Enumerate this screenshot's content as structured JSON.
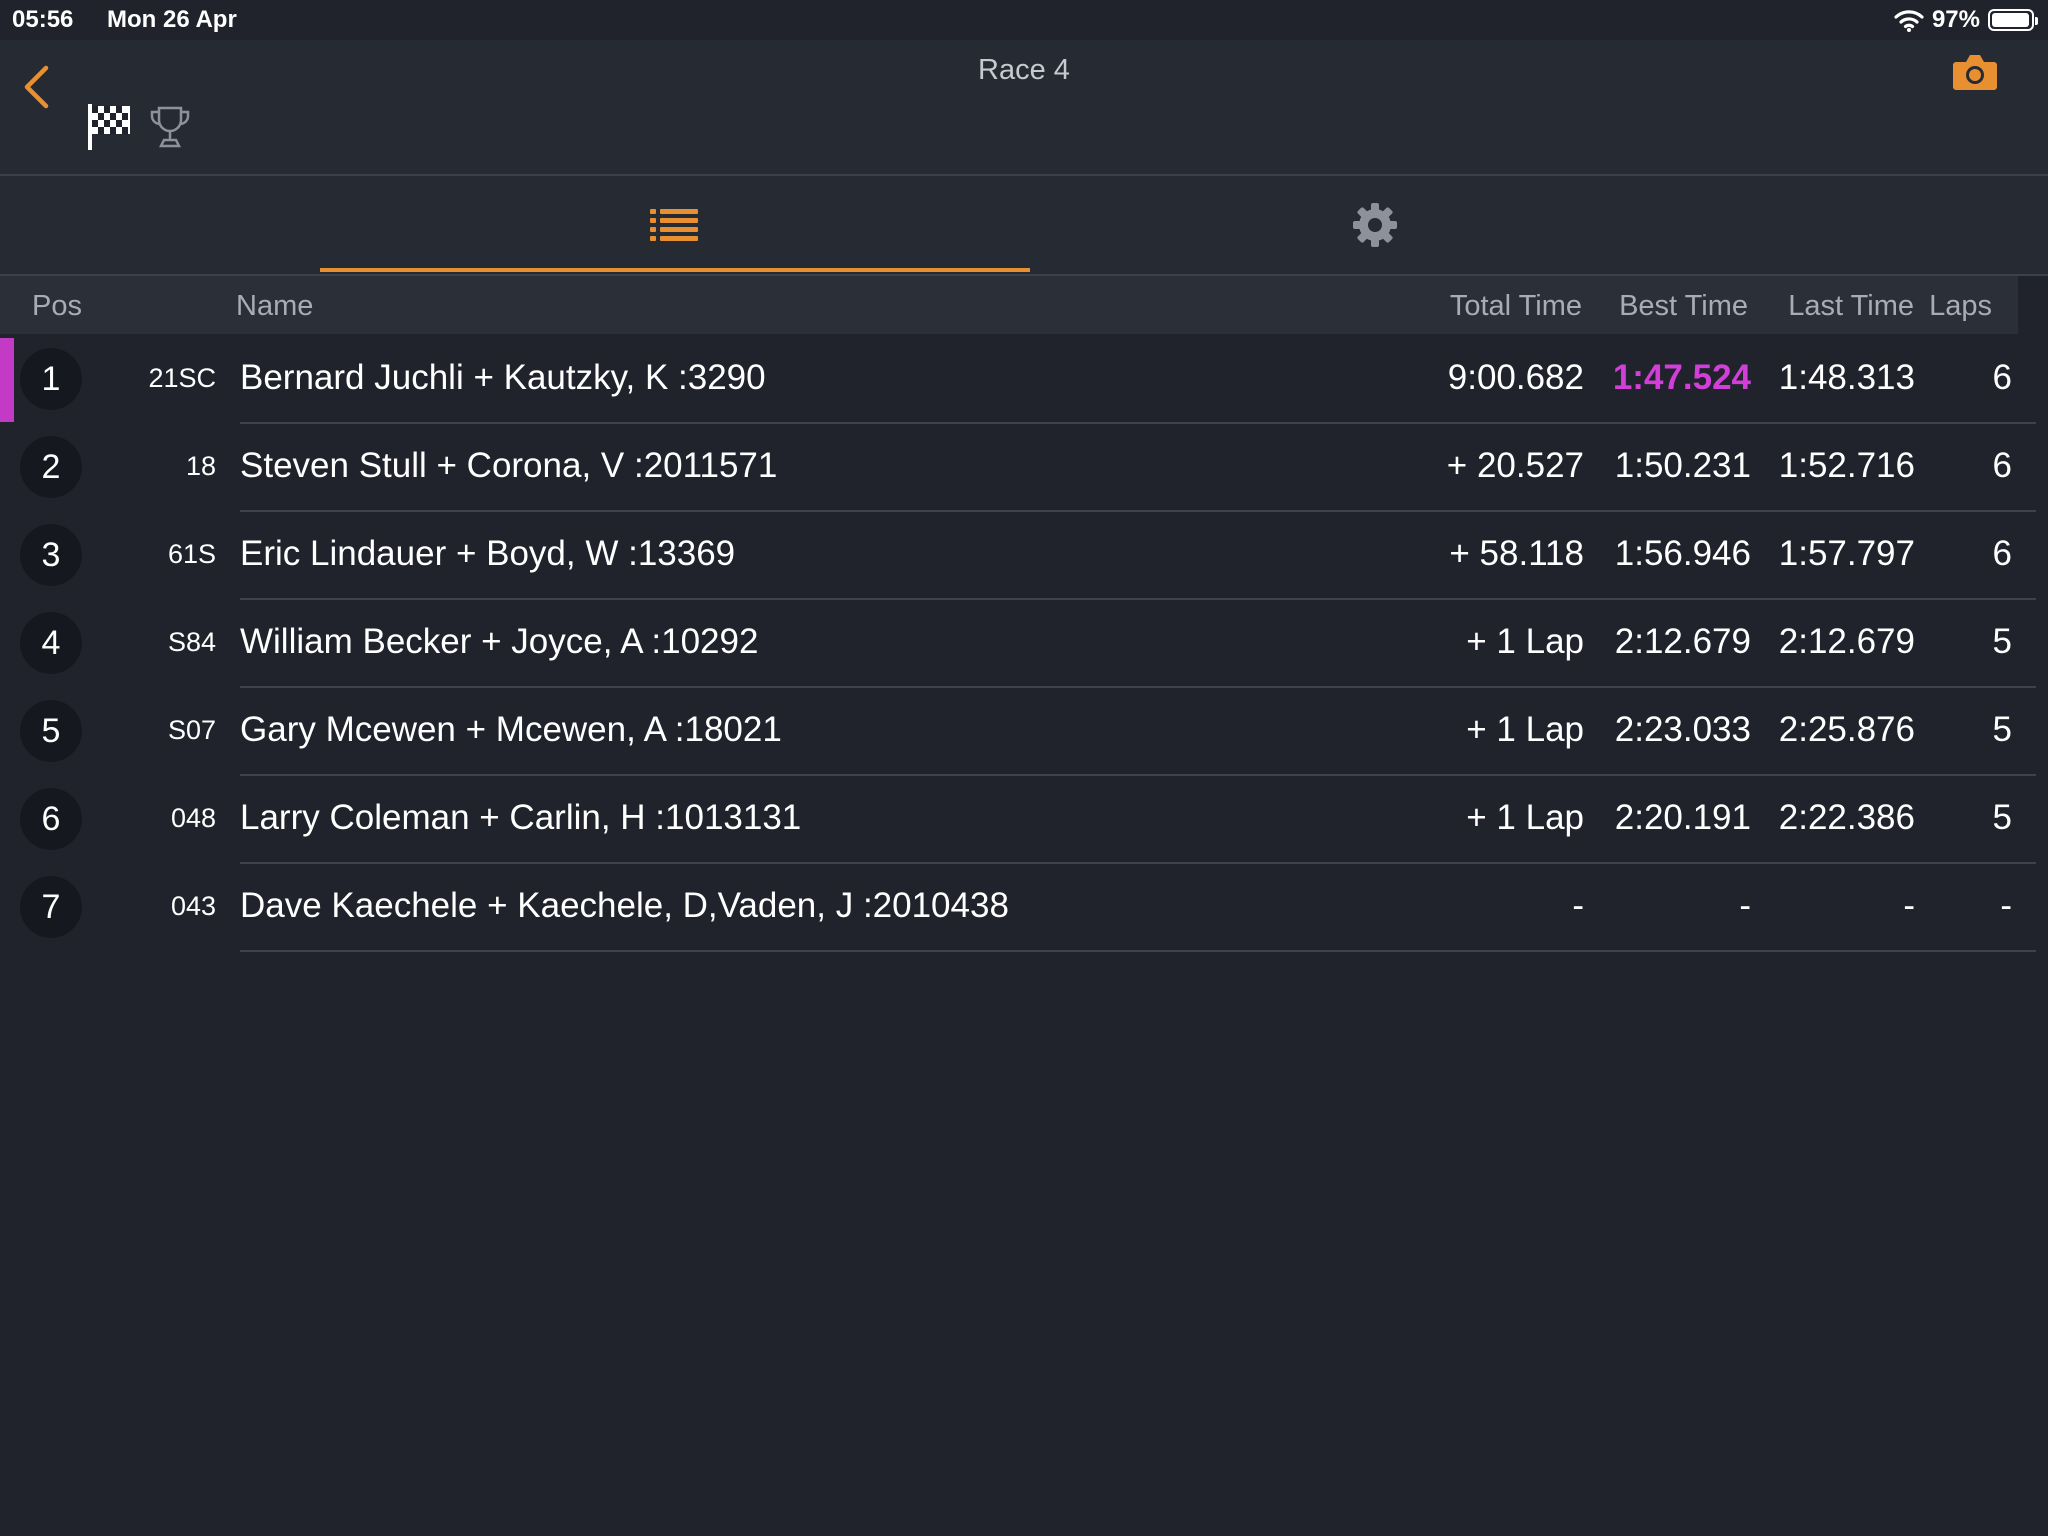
{
  "status": {
    "time": "05:56",
    "date": "Mon 26 Apr",
    "battery": "97%",
    "battery_level": 0.97
  },
  "nav": {
    "title": "Race 4"
  },
  "table": {
    "headers": {
      "pos": "Pos",
      "name": "Name",
      "total": "Total Time",
      "best": "Best Time",
      "last": "Last Time",
      "laps": "Laps"
    },
    "rows": [
      {
        "pos": "1",
        "num": "21SC",
        "name": "Bernard Juchli + Kautzky, K :3290",
        "total": "9:00.682",
        "best": "1:47.524",
        "last": "1:48.313",
        "laps": "6"
      },
      {
        "pos": "2",
        "num": "18",
        "name": "Steven Stull + Corona, V :2011571",
        "total": "+ 20.527",
        "best": "1:50.231",
        "last": "1:52.716",
        "laps": "6"
      },
      {
        "pos": "3",
        "num": "61S",
        "name": "Eric Lindauer + Boyd, W :13369",
        "total": "+ 58.118",
        "best": "1:56.946",
        "last": "1:57.797",
        "laps": "6"
      },
      {
        "pos": "4",
        "num": "S84",
        "name": "William Becker + Joyce, A :10292",
        "total": "+ 1 Lap",
        "best": "2:12.679",
        "last": "2:12.679",
        "laps": "5"
      },
      {
        "pos": "5",
        "num": "S07",
        "name": "Gary Mcewen + Mcewen, A :18021",
        "total": "+ 1 Lap",
        "best": "2:23.033",
        "last": "2:25.876",
        "laps": "5"
      },
      {
        "pos": "6",
        "num": "048",
        "name": "Larry Coleman + Carlin, H :1013131",
        "total": "+ 1 Lap",
        "best": "2:20.191",
        "last": "2:22.386",
        "laps": "5"
      },
      {
        "pos": "7",
        "num": "043",
        "name": "Dave Kaechele + Kaechele, D,Vaden, J :2010438",
        "total": "-",
        "best": "-",
        "last": "-",
        "laps": "-"
      }
    ]
  },
  "colors": {
    "accent": "#e88f32",
    "fastest_lap": "#d13ed8",
    "background": "#20232b"
  },
  "icons": {
    "back": "chevron-left-icon",
    "camera": "camera-icon",
    "flag": "checkered-flag-icon",
    "trophy": "trophy-icon",
    "list_tab": "list-icon",
    "settings_tab": "gear-icon"
  }
}
